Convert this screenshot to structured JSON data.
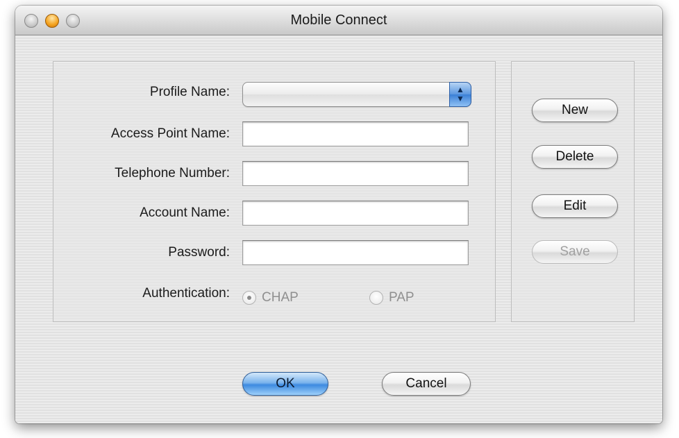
{
  "window": {
    "title": "Mobile Connect"
  },
  "form": {
    "profile_label": "Profile Name:",
    "profile_value": "",
    "apn_label": "Access Point Name:",
    "apn_value": "",
    "telephone_label": "Telephone Number:",
    "telephone_value": "",
    "account_label": "Account Name:",
    "account_value": "",
    "password_label": "Password:",
    "password_value": "",
    "auth_label": "Authentication:",
    "auth_options": [
      {
        "label": "CHAP",
        "selected": true
      },
      {
        "label": "PAP",
        "selected": false
      }
    ]
  },
  "side_buttons": {
    "new_label": "New",
    "delete_label": "Delete",
    "edit_label": "Edit",
    "save_label": "Save"
  },
  "footer": {
    "ok_label": "OK",
    "cancel_label": "Cancel"
  },
  "icons": {
    "popup_arrows": "up-down-arrows-icon",
    "close": "close-window-icon",
    "minimize": "minimize-window-icon",
    "zoom": "zoom-window-icon"
  },
  "colors": {
    "accent": "#3d8ae0",
    "window_bg": "#e6e6e6"
  }
}
